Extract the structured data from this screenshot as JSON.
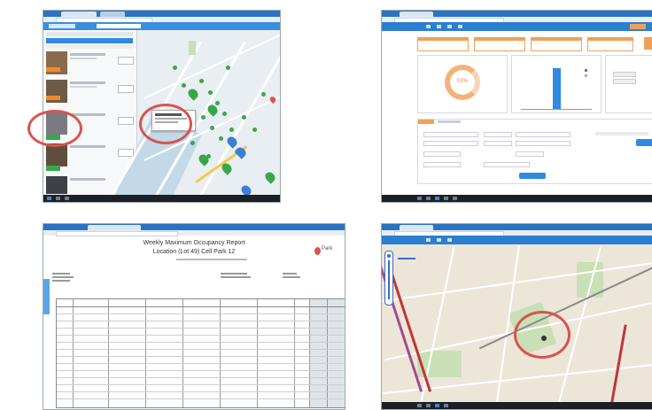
{
  "colors": {
    "highlight_ring": "#d9534f",
    "browser_blue": "#2a73c1",
    "marker_green": "#3aa64a",
    "marker_blue": "#3d7fd6",
    "accent_orange": "#f0a05a"
  },
  "report": {
    "title": "Weekly Maximum Occupancy Report",
    "subtitle": "Location (Lot 49) Cell Park 12",
    "logo_text": "Park"
  },
  "dashboard": {
    "gauge_value": "53%"
  },
  "icons": [
    "marker-pin-icon",
    "zoom-control-icon",
    "taskbar-icon"
  ]
}
